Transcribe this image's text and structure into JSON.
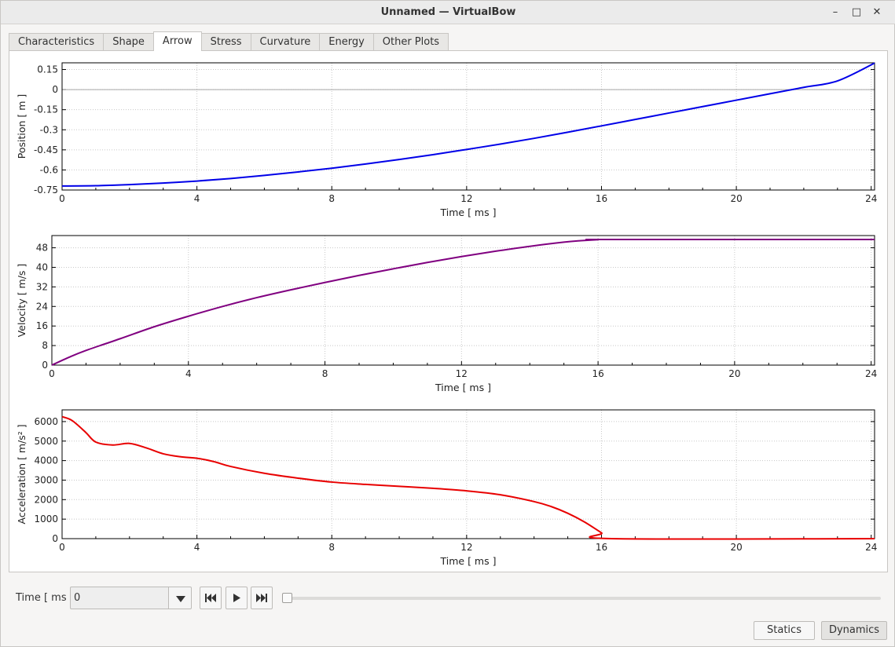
{
  "window": {
    "title": "Unnamed — VirtualBow"
  },
  "tabs": [
    "Characteristics",
    "Shape",
    "Arrow",
    "Stress",
    "Curvature",
    "Energy",
    "Other Plots"
  ],
  "active_tab": "Arrow",
  "controls": {
    "time_label": "Time [ ms ]",
    "time_value": "0",
    "slider_fraction": 0.0
  },
  "buttons": {
    "statics": "Statics",
    "dynamics": "Dynamics"
  },
  "colors": {
    "position": "#0000e8",
    "velocity": "#800080",
    "acceleration": "#e80000",
    "grid": "#c8c8c8"
  },
  "chart_data": [
    {
      "type": "line",
      "xlabel": "Time [ ms ]",
      "ylabel": "Position [ m ]",
      "xlim": [
        0,
        24.1
      ],
      "ylim": [
        -0.75,
        0.2
      ],
      "xticks": [
        0,
        4,
        8,
        12,
        16,
        20,
        24
      ],
      "yticks": [
        0.15,
        0,
        -0.15,
        -0.3,
        -0.45,
        -0.6,
        -0.75
      ],
      "ytick_labels": [
        "0.15",
        "0",
        "-0.15",
        "-0.3",
        "-0.45",
        "-0.6",
        "-0.75"
      ],
      "x": [
        0,
        1,
        2,
        3,
        4,
        5,
        6,
        7,
        8,
        9,
        10,
        11,
        12,
        13,
        14,
        15,
        16,
        17,
        18,
        19,
        20,
        21,
        22,
        23,
        24.1
      ],
      "series": [
        {
          "values": [
            -0.72,
            -0.718,
            -0.71,
            -0.698,
            -0.683,
            -0.664,
            -0.641,
            -0.615,
            -0.587,
            -0.556,
            -0.522,
            -0.486,
            -0.447,
            -0.407,
            -0.364,
            -0.318,
            -0.271,
            -0.223,
            -0.175,
            -0.127,
            -0.079,
            -0.031,
            0.017,
            0.065,
            0.198
          ]
        }
      ]
    },
    {
      "type": "line",
      "xlabel": "Time [ ms ]",
      "ylabel": "Velocity [ m/s ]",
      "xlim": [
        0,
        24.1
      ],
      "ylim": [
        0,
        53
      ],
      "xticks": [
        0,
        4,
        8,
        12,
        16,
        20,
        24
      ],
      "yticks": [
        0,
        8,
        16,
        24,
        32,
        40,
        48
      ],
      "ytick_labels": [
        "0",
        "8",
        "16",
        "24",
        "32",
        "40",
        "48"
      ],
      "x": [
        0,
        0.5,
        1,
        2,
        3,
        4,
        5,
        6,
        7,
        8,
        9,
        10,
        11,
        12,
        13,
        14,
        15,
        15.5,
        16,
        16.3,
        24.1
      ],
      "series": [
        {
          "values": [
            0,
            3.2,
            6,
            10.8,
            15.7,
            20,
            24,
            27.6,
            30.8,
            33.8,
            36.7,
            39.4,
            42,
            44.4,
            46.6,
            48.6,
            50.3,
            50.9,
            51.3,
            51.4,
            51.4
          ]
        }
      ]
    },
    {
      "type": "line",
      "xlabel": "Time [ ms ]",
      "ylabel": "Acceleration [ m/s² ]",
      "xlim": [
        0,
        24.1
      ],
      "ylim": [
        0,
        6600
      ],
      "xticks": [
        0,
        4,
        8,
        12,
        16,
        20,
        24
      ],
      "yticks": [
        0,
        1000,
        2000,
        3000,
        4000,
        5000,
        6000
      ],
      "ytick_labels": [
        "0",
        "1000",
        "2000",
        "3000",
        "4000",
        "5000",
        "6000"
      ],
      "x": [
        0,
        0.3,
        0.7,
        1.0,
        1.5,
        2.0,
        2.5,
        3.0,
        3.5,
        4.0,
        4.5,
        5.0,
        6.0,
        7.0,
        8.0,
        9.0,
        10.0,
        11.0,
        12.0,
        13.0,
        14.0,
        14.5,
        15.0,
        15.5,
        16.0,
        16.3,
        24.1
      ],
      "series": [
        {
          "values": [
            6250,
            6050,
            5450,
            4950,
            4800,
            4880,
            4650,
            4350,
            4200,
            4120,
            3950,
            3700,
            3350,
            3100,
            2900,
            2780,
            2680,
            2580,
            2450,
            2250,
            1900,
            1650,
            1300,
            850,
            300,
            0,
            0
          ]
        }
      ]
    }
  ]
}
